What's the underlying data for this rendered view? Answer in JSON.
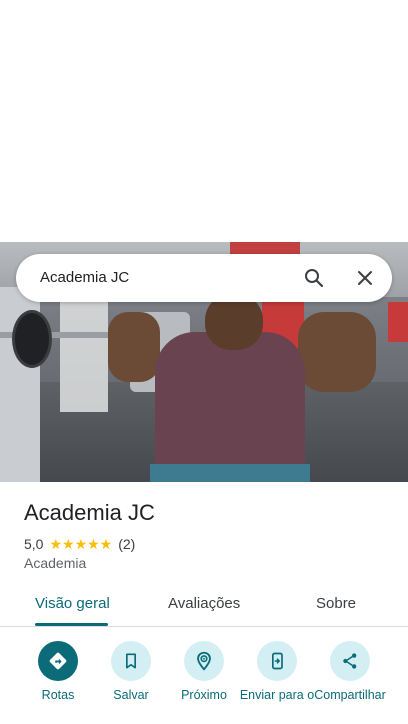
{
  "search": {
    "query": "Academia JC"
  },
  "place": {
    "name": "Academia JC",
    "rating": "5,0",
    "stars": "★★★★★",
    "review_count": "(2)",
    "category": "Academia"
  },
  "tabs": [
    {
      "label": "Visão geral",
      "active": true
    },
    {
      "label": "Avaliações",
      "active": false
    },
    {
      "label": "Sobre",
      "active": false
    }
  ],
  "actions": [
    {
      "label": "Rotas",
      "icon": "directions-icon"
    },
    {
      "label": "Salvar",
      "icon": "bookmark-icon"
    },
    {
      "label": "Próximo",
      "icon": "nearby-icon"
    },
    {
      "label": "Enviar para o",
      "icon": "send-to-phone-icon"
    },
    {
      "label": "Compartilhar",
      "icon": "share-icon"
    }
  ],
  "colors": {
    "accent": "#0b6b78",
    "accent_light": "#d3eff4",
    "star": "#fbbc04"
  }
}
